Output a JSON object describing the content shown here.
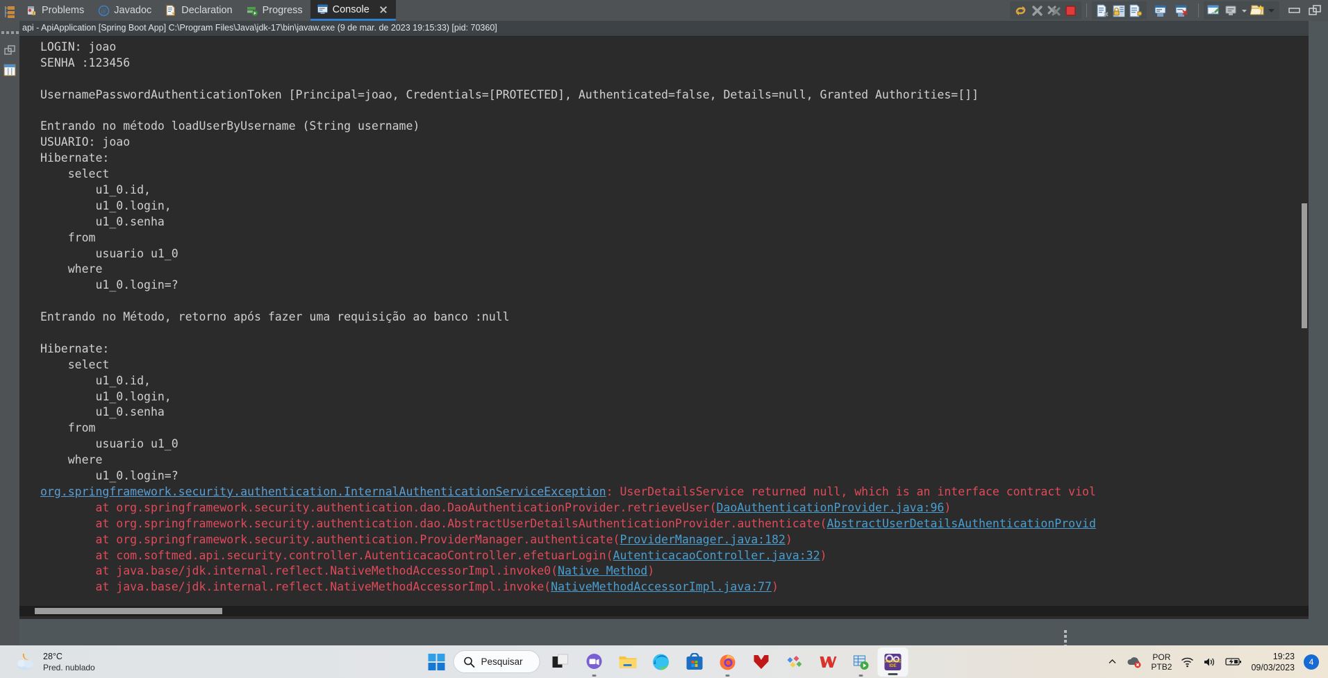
{
  "tabs": [
    {
      "label": "Problems",
      "icon": "problems-icon",
      "active": false
    },
    {
      "label": "Javadoc",
      "icon": "javadoc-icon",
      "active": false
    },
    {
      "label": "Declaration",
      "icon": "declaration-icon",
      "active": false
    },
    {
      "label": "Progress",
      "icon": "progress-icon",
      "active": false
    },
    {
      "label": "Console",
      "icon": "console-icon",
      "active": true
    }
  ],
  "toolbar": {
    "group1": [
      "relaunch-icon",
      "terminate-icon",
      "terminate-all-icon",
      "stop-icon"
    ],
    "group2": [
      "remove-launch-icon",
      "lock-scroll-icon",
      "scroll-lock-icon",
      "word-wrap-icon",
      "clear-console-icon"
    ],
    "group3": [
      "display-selected-console-icon",
      "open-console-icon",
      "open-console-dropdown-icon",
      "new-console-icon",
      "new-console-dropdown-icon"
    ],
    "group4": [
      "minimize-icon",
      "maximize-icon"
    ]
  },
  "console": {
    "title": "api - ApiApplication [Spring Boot App] C:\\Program Files\\Java\\jdk-17\\bin\\javaw.exe  (9 de mar. de 2023 19:15:33) [pid: 70360]",
    "lines": [
      {
        "t": "LOGIN: joao",
        "k": "out"
      },
      {
        "t": "SENHA :123456",
        "k": "out"
      },
      {
        "t": "",
        "k": "out"
      },
      {
        "t": "UsernamePasswordAuthenticationToken [Principal=joao, Credentials=[PROTECTED], Authenticated=false, Details=null, Granted Authorities=[]]",
        "k": "out"
      },
      {
        "t": "",
        "k": "out"
      },
      {
        "t": "Entrando no método loadUserByUsername (String username)",
        "k": "out"
      },
      {
        "t": "USUARIO: joao",
        "k": "out"
      },
      {
        "t": "Hibernate: ",
        "k": "out"
      },
      {
        "t": "    select",
        "k": "out"
      },
      {
        "t": "        u1_0.id,",
        "k": "out"
      },
      {
        "t": "        u1_0.login,",
        "k": "out"
      },
      {
        "t": "        u1_0.senha",
        "k": "out"
      },
      {
        "t": "    from",
        "k": "out"
      },
      {
        "t": "        usuario u1_0",
        "k": "out"
      },
      {
        "t": "    where",
        "k": "out"
      },
      {
        "t": "        u1_0.login=?",
        "k": "out"
      },
      {
        "t": "",
        "k": "out"
      },
      {
        "t": "Entrando no Método, retorno após fazer uma requisição ao banco :null",
        "k": "out"
      },
      {
        "t": "",
        "k": "out"
      },
      {
        "t": "Hibernate: ",
        "k": "out"
      },
      {
        "t": "    select",
        "k": "out"
      },
      {
        "t": "        u1_0.id,",
        "k": "out"
      },
      {
        "t": "        u1_0.login,",
        "k": "out"
      },
      {
        "t": "        u1_0.senha",
        "k": "out"
      },
      {
        "t": "    from",
        "k": "out"
      },
      {
        "t": "        usuario u1_0",
        "k": "out"
      },
      {
        "t": "    where",
        "k": "out"
      },
      {
        "t": "        u1_0.login=?",
        "k": "out"
      }
    ],
    "exception": {
      "link": "org.springframework.security.authentication.InternalAuthenticationServiceException",
      "sep": ": ",
      "message": "UserDetailsService returned null, which is an interface contract viol"
    },
    "stack": [
      {
        "pre": "        at org.springframework.security.authentication.dao.DaoAuthenticationProvider.retrieveUser(",
        "link": "DaoAuthenticationProvider.java:96",
        "post": ")"
      },
      {
        "pre": "        at org.springframework.security.authentication.dao.AbstractUserDetailsAuthenticationProvider.authenticate(",
        "link": "AbstractUserDetailsAuthenticationProvid",
        "post": ""
      },
      {
        "pre": "        at org.springframework.security.authentication.ProviderManager.authenticate(",
        "link": "ProviderManager.java:182",
        "post": ")"
      },
      {
        "pre": "        at com.softmed.api.security.controller.AutenticacaoController.efetuarLogin(",
        "link": "AutenticacaoController.java:32",
        "post": ")"
      },
      {
        "pre": "        at java.base/jdk.internal.reflect.NativeMethodAccessorImpl.invoke0(",
        "link": "Native Method",
        "post": ")"
      },
      {
        "pre": "        at java.base/jdk.internal.reflect.NativeMethodAccessorImpl.invoke(",
        "link": "NativeMethodAccessorImpl.java:77",
        "post": ")"
      }
    ]
  },
  "taskbar": {
    "weather": {
      "temp": "28°C",
      "condition": "Pred. nublado",
      "icon": "partly-cloudy-night-icon"
    },
    "start_icon": "windows-start-icon",
    "search_placeholder": "Pesquisar",
    "search_icon": "search-icon",
    "apps": [
      {
        "name": "task-view",
        "icon": "task-view-icon"
      },
      {
        "name": "teams",
        "icon": "teams-icon"
      },
      {
        "name": "file-explorer",
        "icon": "file-explorer-icon"
      },
      {
        "name": "microsoft-edge",
        "icon": "edge-icon"
      },
      {
        "name": "microsoft-store",
        "icon": "store-icon"
      },
      {
        "name": "firefox",
        "icon": "firefox-icon"
      },
      {
        "name": "mcafee",
        "icon": "mcafee-icon"
      },
      {
        "name": "wps-office",
        "icon": "wps-office-icon"
      },
      {
        "name": "wps-writer",
        "icon": "wps-writer-icon"
      },
      {
        "name": "dbeaver",
        "icon": "dbeaver-icon"
      },
      {
        "name": "eclipse-java-ee-ide",
        "icon": "eclipse-icon"
      }
    ],
    "tray": {
      "chevron_icon": "show-hidden-icons-chevron",
      "onedrive_icon": "onedrive-error-icon",
      "lang_line1": "POR",
      "lang_line2": "PTB2",
      "wifi_icon": "wifi-icon",
      "volume_icon": "volume-icon",
      "battery_icon": "battery-charging-icon",
      "time": "19:23",
      "date": "09/03/2023",
      "notification_count": "4"
    }
  }
}
